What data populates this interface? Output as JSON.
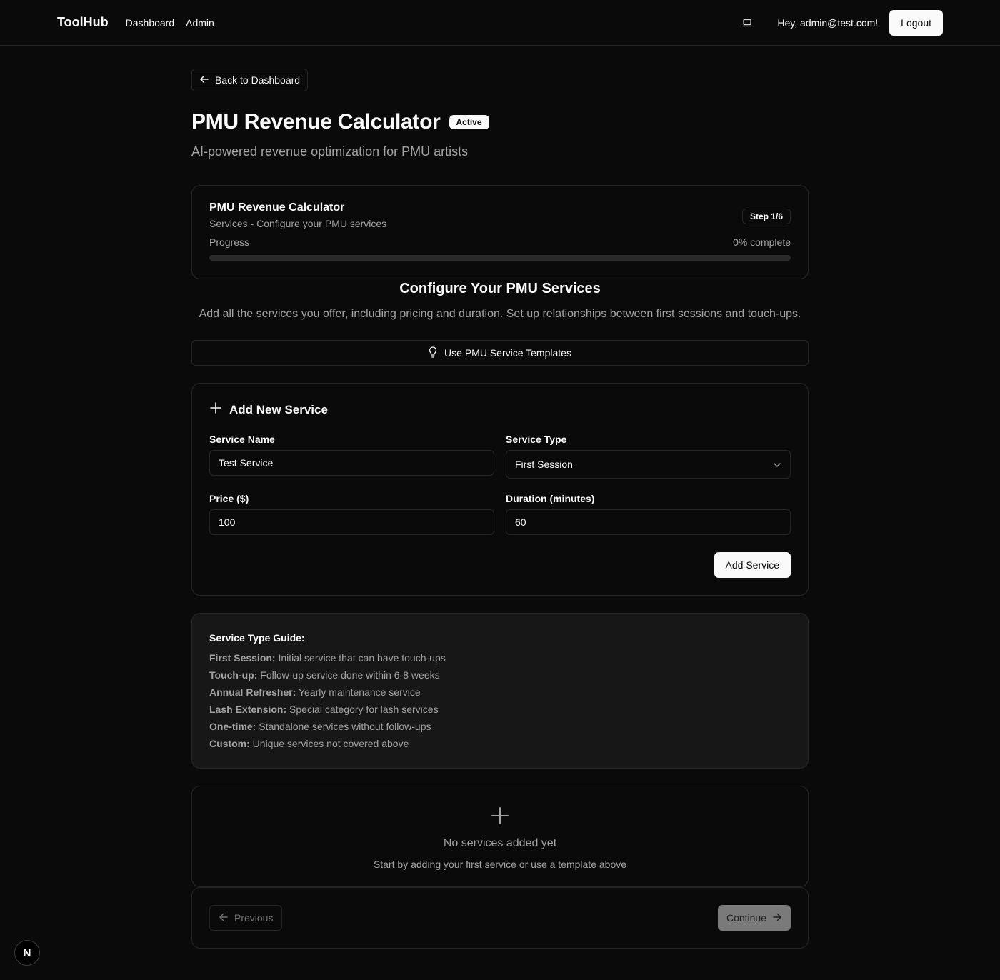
{
  "navbar": {
    "brand": "ToolHub",
    "links": [
      "Dashboard",
      "Admin"
    ],
    "greeting": "Hey, admin@test.com!",
    "logout_label": "Logout",
    "theme_icon": "laptop-icon"
  },
  "header": {
    "back_label": "Back to Dashboard",
    "title": "PMU Revenue Calculator",
    "status": "Active",
    "subtitle": "AI-powered revenue optimization for PMU artists"
  },
  "progress_card": {
    "title": "PMU Revenue Calculator",
    "subtitle": "Services - Configure your PMU services",
    "step": "Step 1/6",
    "progress_label": "Progress",
    "progress_text": "0% complete",
    "progress_value": 0
  },
  "section": {
    "title": "Configure Your PMU Services",
    "description": "Add all the services you offer, including pricing and duration. Set up relationships between first sessions and touch-ups."
  },
  "template_button": {
    "label": "Use PMU Service Templates",
    "icon": "lightbulb-icon"
  },
  "add_service": {
    "title": "Add New Service",
    "name_label": "Service Name",
    "name_value": "Test Service",
    "type_label": "Service Type",
    "type_value": "First Session",
    "price_label": "Price ($)",
    "price_value": "100",
    "duration_label": "Duration (minutes)",
    "duration_value": "60",
    "submit_label": "Add Service"
  },
  "guide": {
    "title": "Service Type Guide:",
    "items": [
      {
        "term": "First Session:",
        "desc": " Initial service that can have touch-ups"
      },
      {
        "term": "Touch-up:",
        "desc": " Follow-up service done within 6-8 weeks"
      },
      {
        "term": "Annual Refresher:",
        "desc": " Yearly maintenance service"
      },
      {
        "term": "Lash Extension:",
        "desc": " Special category for lash services"
      },
      {
        "term": "One-time:",
        "desc": " Standalone services without follow-ups"
      },
      {
        "term": "Custom:",
        "desc": " Unique services not covered above"
      }
    ]
  },
  "empty_state": {
    "title": "No services added yet",
    "subtitle": "Start by adding your first service or use a template above"
  },
  "footer_nav": {
    "previous_label": "Previous",
    "continue_label": "Continue"
  },
  "dev_badge": "N",
  "colors": {
    "background": "#0a0a0a",
    "foreground": "#fafafa",
    "muted": "#a3a3a3",
    "border": "#262626"
  }
}
